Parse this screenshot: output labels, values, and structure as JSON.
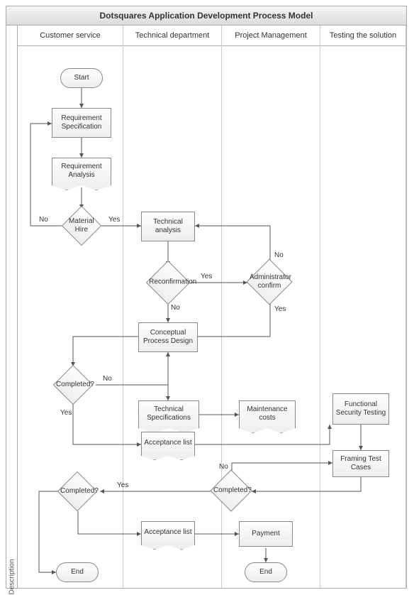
{
  "title": "Dotsquares Application Development Process Model",
  "description_label": "Description",
  "lanes": {
    "l1": "Customer service",
    "l2": "Technical department",
    "l3": "Project Management",
    "l4": "Testing the solution"
  },
  "nodes": {
    "start": "Start",
    "req_spec": "Requirement Specification",
    "req_analysis": "Requirement Analysis",
    "material_hire": "Material Hire",
    "tech_analysis": "Technical analysis",
    "reconfirm": "Reconfirmation",
    "admin_confirm": "Administrator confirm",
    "concept_design": "Conceptual Process Design",
    "completed1": "Completed?",
    "tech_specs": "Technical Specifications",
    "maint_costs": "Maintenance costs",
    "accept_list1": "Acceptance list",
    "func_sec_test": "Functional Security Testing",
    "framing_tc": "Framing Test Cases",
    "completed2": "Completed?",
    "completed3": "Completed?",
    "accept_list2": "Acceptance list",
    "payment": "Payment",
    "end1": "End",
    "end2": "End"
  },
  "edge_labels": {
    "no": "No",
    "yes": "Yes"
  }
}
